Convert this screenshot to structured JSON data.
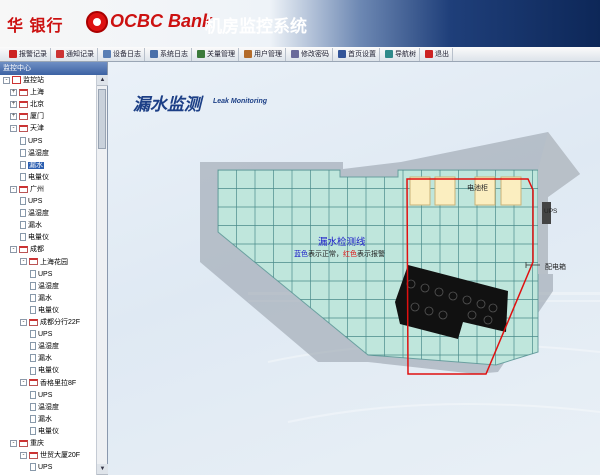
{
  "header": {
    "logo_cn": "华 银行",
    "bank_name": "OCBC Bank",
    "system_title": "机房监控系统"
  },
  "toolbar": {
    "items": [
      {
        "label": "报警记录",
        "icon": "alarm-record-icon",
        "color": "#cc2222"
      },
      {
        "label": "通知记录",
        "icon": "notify-record-icon",
        "color": "#cc3333"
      },
      {
        "label": "设备日志",
        "icon": "device-log-icon",
        "color": "#5a7fb5"
      },
      {
        "label": "系统日志",
        "icon": "system-log-icon",
        "color": "#4a70aa"
      },
      {
        "label": "关量管理",
        "icon": "switch-manage-icon",
        "color": "#3b7a3b"
      },
      {
        "label": "用户管理",
        "icon": "user-manage-icon",
        "color": "#b36b2a"
      },
      {
        "label": "修改密码",
        "icon": "change-password-icon",
        "color": "#6a6a9a"
      },
      {
        "label": "首页设置",
        "icon": "home-settings-icon",
        "color": "#335599"
      },
      {
        "label": "导航树",
        "icon": "nav-tree-icon",
        "color": "#2f8a8a"
      },
      {
        "label": "退出",
        "icon": "exit-icon",
        "color": "#cc2222"
      }
    ]
  },
  "sidebar": {
    "title": "监控中心",
    "tree": [
      {
        "label": "监控站",
        "level": 0,
        "kind": "root",
        "exp": "-"
      },
      {
        "label": "上海",
        "level": 1,
        "kind": "folder",
        "exp": "+"
      },
      {
        "label": "北京",
        "level": 1,
        "kind": "folder",
        "exp": "+"
      },
      {
        "label": "厦门",
        "level": 1,
        "kind": "folder",
        "exp": "+"
      },
      {
        "label": "天津",
        "level": 1,
        "kind": "folder",
        "exp": "-"
      },
      {
        "label": "UPS",
        "level": 2,
        "kind": "leaf"
      },
      {
        "label": "温湿度",
        "level": 2,
        "kind": "leaf"
      },
      {
        "label": "漏水",
        "level": 2,
        "kind": "leaf",
        "selected": true
      },
      {
        "label": "电量仪",
        "level": 2,
        "kind": "leaf"
      },
      {
        "label": "广州",
        "level": 1,
        "kind": "folder",
        "exp": "-"
      },
      {
        "label": "UPS",
        "level": 2,
        "kind": "leaf"
      },
      {
        "label": "温湿度",
        "level": 2,
        "kind": "leaf"
      },
      {
        "label": "漏水",
        "level": 2,
        "kind": "leaf"
      },
      {
        "label": "电量仪",
        "level": 2,
        "kind": "leaf"
      },
      {
        "label": "成都",
        "level": 1,
        "kind": "folder",
        "exp": "-"
      },
      {
        "label": "上海花园",
        "level": 2,
        "kind": "folder",
        "exp": "-"
      },
      {
        "label": "UPS",
        "level": 3,
        "kind": "leaf"
      },
      {
        "label": "温湿度",
        "level": 3,
        "kind": "leaf"
      },
      {
        "label": "漏水",
        "level": 3,
        "kind": "leaf"
      },
      {
        "label": "电量仪",
        "level": 3,
        "kind": "leaf"
      },
      {
        "label": "成都分行22F",
        "level": 2,
        "kind": "folder",
        "exp": "-"
      },
      {
        "label": "UPS",
        "level": 3,
        "kind": "leaf"
      },
      {
        "label": "温湿度",
        "level": 3,
        "kind": "leaf"
      },
      {
        "label": "漏水",
        "level": 3,
        "kind": "leaf"
      },
      {
        "label": "电量仪",
        "level": 3,
        "kind": "leaf"
      },
      {
        "label": "香格里拉8F",
        "level": 2,
        "kind": "folder",
        "exp": "-"
      },
      {
        "label": "UPS",
        "level": 3,
        "kind": "leaf"
      },
      {
        "label": "温湿度",
        "level": 3,
        "kind": "leaf"
      },
      {
        "label": "漏水",
        "level": 3,
        "kind": "leaf"
      },
      {
        "label": "电量仪",
        "level": 3,
        "kind": "leaf"
      },
      {
        "label": "重庆",
        "level": 1,
        "kind": "folder",
        "exp": "-"
      },
      {
        "label": "世贸大厦20F",
        "level": 2,
        "kind": "folder",
        "exp": "-"
      },
      {
        "label": "UPS",
        "level": 3,
        "kind": "leaf"
      }
    ]
  },
  "main": {
    "title": "漏水监测",
    "subtitle": "Leak Monitoring",
    "sensor_label": "漏水检测线",
    "legend_blue": "蓝色",
    "legend_normal": "表示正常，",
    "legend_red": "红色",
    "legend_alarm": "表示报警",
    "battery_label": "电池柜",
    "ups_label": "UPS",
    "dist_label": "配电箱",
    "colors": {
      "floor": "#bfe6dc",
      "grid_line": "#4a8a8a",
      "leak_line_normal": "#1a1ac8",
      "leak_line_alarm": "#e01010",
      "battery": "#fbeec0"
    }
  }
}
